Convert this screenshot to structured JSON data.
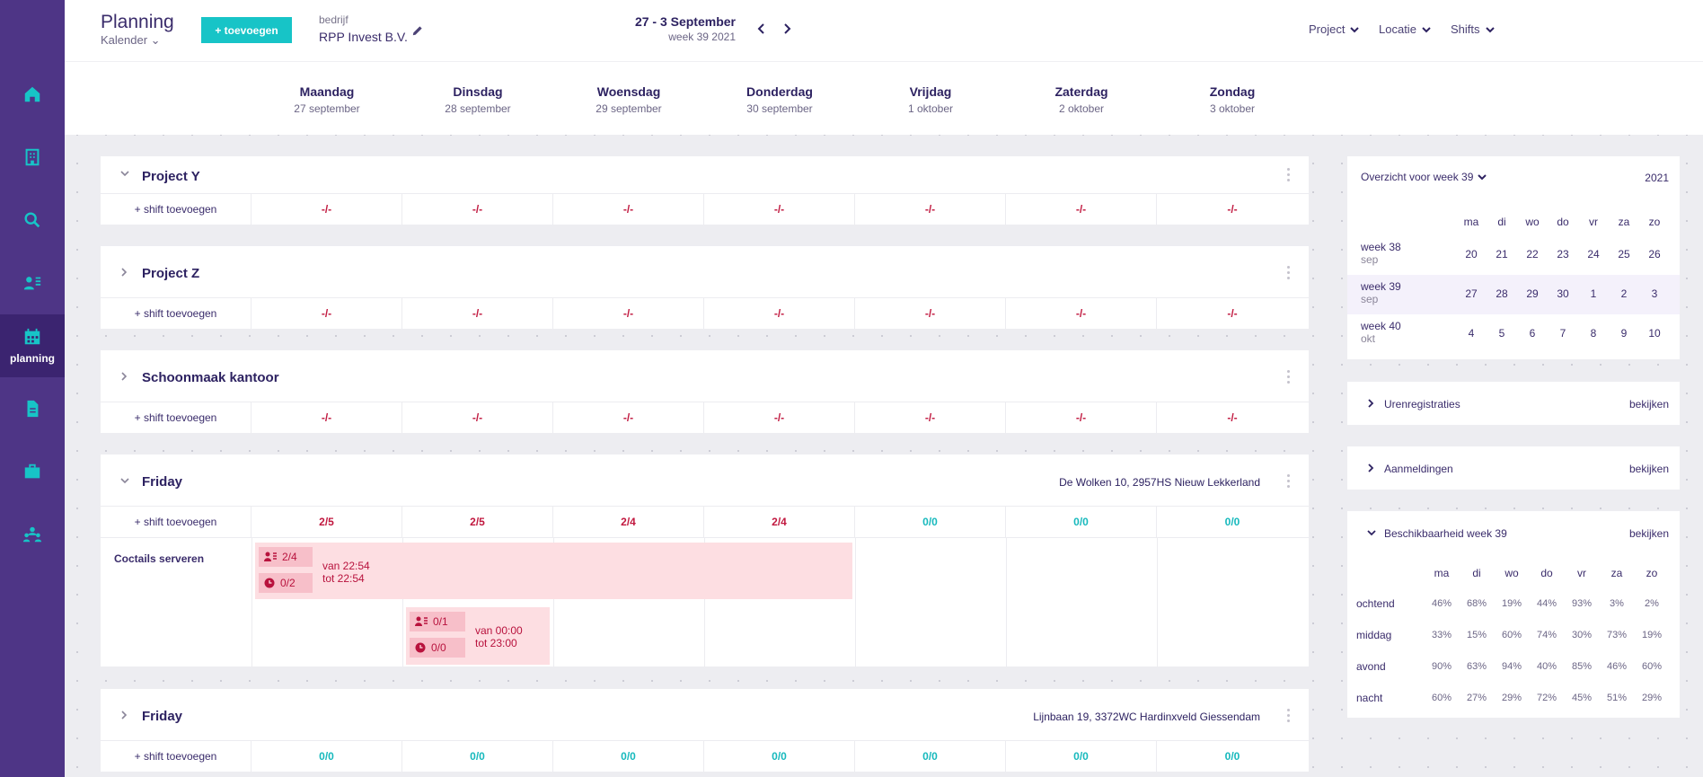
{
  "sidebar": {
    "items": [
      {
        "name": "home",
        "label": ""
      },
      {
        "name": "building",
        "label": ""
      },
      {
        "name": "search",
        "label": ""
      },
      {
        "name": "users",
        "label": ""
      },
      {
        "name": "planning",
        "label": "planning",
        "active": true
      },
      {
        "name": "document",
        "label": ""
      },
      {
        "name": "briefcase",
        "label": ""
      },
      {
        "name": "team",
        "label": ""
      }
    ]
  },
  "header": {
    "title": "Planning",
    "view": "Kalender",
    "add_label": "+ toevoegen",
    "company_label": "bedrijf",
    "company": "RPP Invest B.V.",
    "date_range": "27 - 3  September",
    "week": "week 39  2021",
    "filters": [
      "Project",
      "Locatie",
      "Shifts"
    ]
  },
  "days": [
    {
      "name": "Maandag",
      "date": "27 september"
    },
    {
      "name": "Dinsdag",
      "date": "28 september"
    },
    {
      "name": "Woensdag",
      "date": "29 september"
    },
    {
      "name": "Donderdag",
      "date": "30 september"
    },
    {
      "name": "Vrijdag",
      "date": "1 oktober"
    },
    {
      "name": "Zaterdag",
      "date": "2 oktober"
    },
    {
      "name": "Zondag",
      "date": "3 oktober"
    }
  ],
  "add_shift_label": "+ shift toevoegen",
  "projects": [
    {
      "name": "Project Y",
      "address": "",
      "counts": [
        "-/-",
        "-/-",
        "-/-",
        "-/-",
        "-/-",
        "-/-",
        "-/-"
      ]
    },
    {
      "name": "Project Z",
      "address": "",
      "counts": [
        "-/-",
        "-/-",
        "-/-",
        "-/-",
        "-/-",
        "-/-",
        "-/-"
      ]
    },
    {
      "name": "Schoonmaak kantoor",
      "address": "",
      "counts": [
        "-/-",
        "-/-",
        "-/-",
        "-/-",
        "-/-",
        "-/-",
        "-/-"
      ]
    },
    {
      "name": "Friday",
      "address": "De Wolken 10, 2957HS Nieuw Lekkerland",
      "counts": [
        "2/5",
        "2/5",
        "2/4",
        "2/4",
        "0/0",
        "0/0",
        "0/0"
      ],
      "job": {
        "name": "Coctails serveren",
        "shifts": [
          {
            "staff": "2/4",
            "clock": "0/2",
            "from": "van 22:54",
            "to": "tot 22:54"
          },
          {
            "staff": "0/1",
            "clock": "0/0",
            "from": "van 00:00",
            "to": "tot 23:00"
          }
        ]
      }
    },
    {
      "name": "Friday",
      "address": "Lijnbaan 19, 3372WC Hardinxveld Giessendam",
      "counts": [
        "0/0",
        "0/0",
        "0/0",
        "0/0",
        "0/0",
        "0/0",
        "0/0"
      ]
    }
  ],
  "overview": {
    "title": "Overzicht voor week 39",
    "year": "2021",
    "day_heads": [
      "ma",
      "di",
      "wo",
      "do",
      "vr",
      "za",
      "zo"
    ],
    "weeks": [
      {
        "week": "week 38",
        "month": "sep",
        "days": [
          "20",
          "21",
          "22",
          "23",
          "24",
          "25",
          "26"
        ]
      },
      {
        "week": "week 39",
        "month": "sep",
        "days": [
          "27",
          "28",
          "29",
          "30",
          "1",
          "2",
          "3"
        ],
        "current": true
      },
      {
        "week": "week 40",
        "month": "okt",
        "days": [
          "4",
          "5",
          "6",
          "7",
          "8",
          "9",
          "10"
        ]
      }
    ]
  },
  "sections": {
    "uren": "Urenregistraties",
    "aanmeldingen": "Aanmeldingen",
    "view_label": "bekijken"
  },
  "availability": {
    "title": "Beschikbaarheid week 39",
    "day_heads": [
      "ma",
      "di",
      "wo",
      "do",
      "vr",
      "za",
      "zo"
    ],
    "rows": [
      {
        "label": "ochtend",
        "values": [
          "46%",
          "68%",
          "19%",
          "44%",
          "93%",
          "3%",
          "2%"
        ]
      },
      {
        "label": "middag",
        "values": [
          "33%",
          "15%",
          "60%",
          "74%",
          "30%",
          "73%",
          "19%"
        ]
      },
      {
        "label": "avond",
        "values": [
          "90%",
          "63%",
          "94%",
          "40%",
          "85%",
          "46%",
          "60%"
        ]
      },
      {
        "label": "nacht",
        "values": [
          "60%",
          "27%",
          "29%",
          "72%",
          "45%",
          "51%",
          "29%"
        ]
      }
    ]
  },
  "colors": {
    "sidebar": "#4e3586",
    "accent": "#17c4c7",
    "warning": "#c1183f",
    "block": "#fddee2"
  }
}
